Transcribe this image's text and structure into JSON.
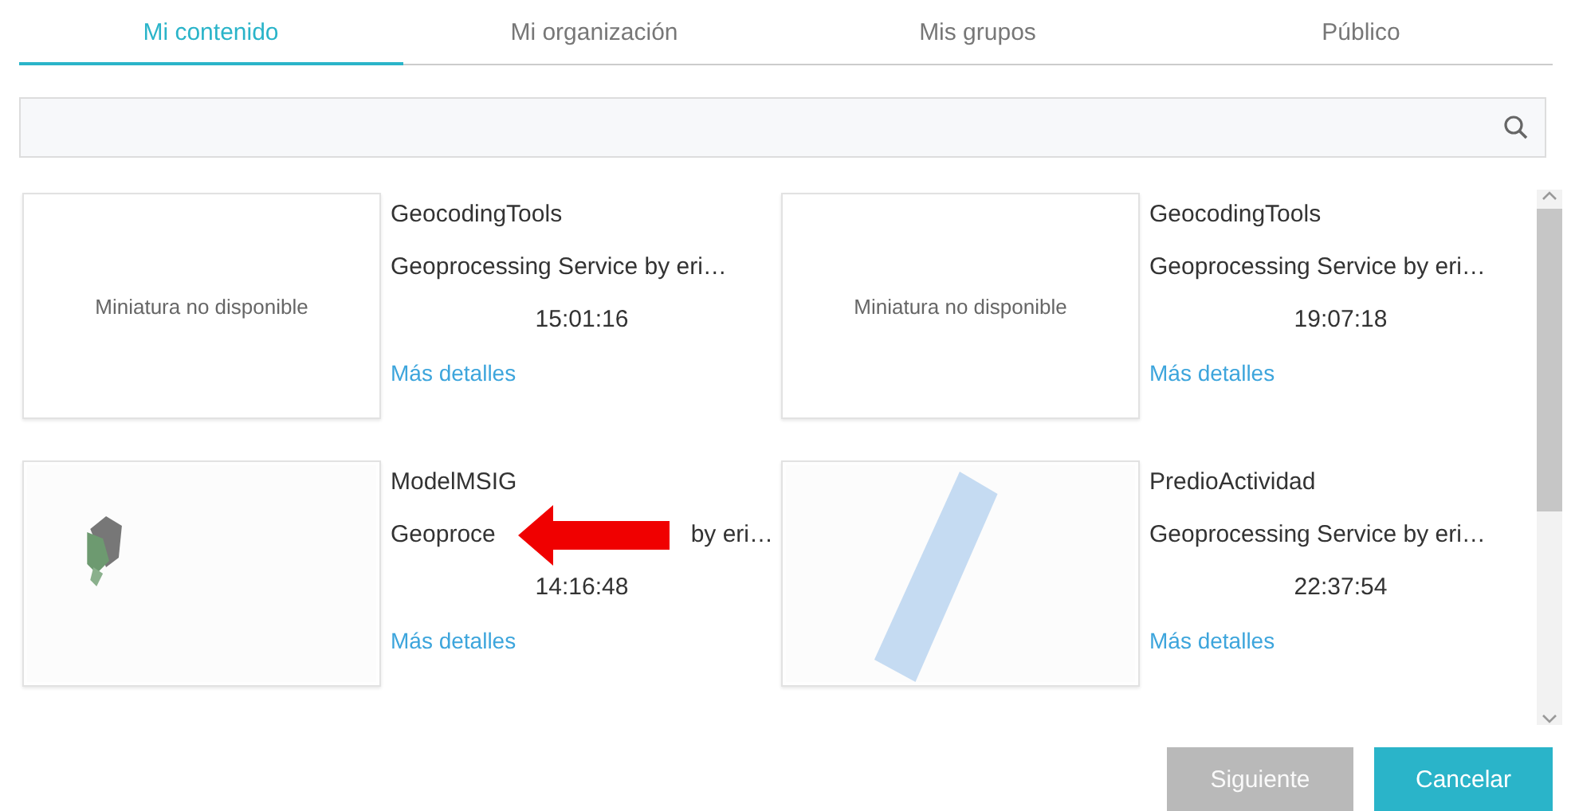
{
  "tabs": [
    {
      "label": "Mi contenido",
      "selected": true
    },
    {
      "label": "Mi organización",
      "selected": false
    },
    {
      "label": "Mis grupos",
      "selected": false
    },
    {
      "label": "Público",
      "selected": false
    }
  ],
  "items": [
    {
      "thumbnail": {
        "kind": "text",
        "text": "Miniatura no disponible"
      },
      "title": "GeocodingTools",
      "description": [
        "Geoprocessing Service by eri…"
      ],
      "time": "15:01:16",
      "link": "Más detalles",
      "arrow": false
    },
    {
      "thumbnail": {
        "kind": "text",
        "text": "Miniatura no disponible"
      },
      "title": "GeocodingTools",
      "description": [
        "Geoprocessing Service by eri…"
      ],
      "time": "19:07:18",
      "link": "Más detalles",
      "arrow": false
    },
    {
      "thumbnail": {
        "kind": "picture"
      },
      "title": "ModelMSIG",
      "description": [
        "Geoproce",
        "by eri…"
      ],
      "time": "14:16:48",
      "link": "Más detalles",
      "arrow": true
    },
    {
      "thumbnail": {
        "kind": "picture"
      },
      "title": "PredioActividad",
      "description": [
        "Geoprocessing Service by eri…"
      ],
      "time": "22:37:54",
      "link": "Más detalles",
      "arrow": false
    }
  ],
  "buttons": [
    {
      "label": "Siguiente",
      "disabled": true
    },
    {
      "label": "Cancelar",
      "disabled": false
    }
  ]
}
